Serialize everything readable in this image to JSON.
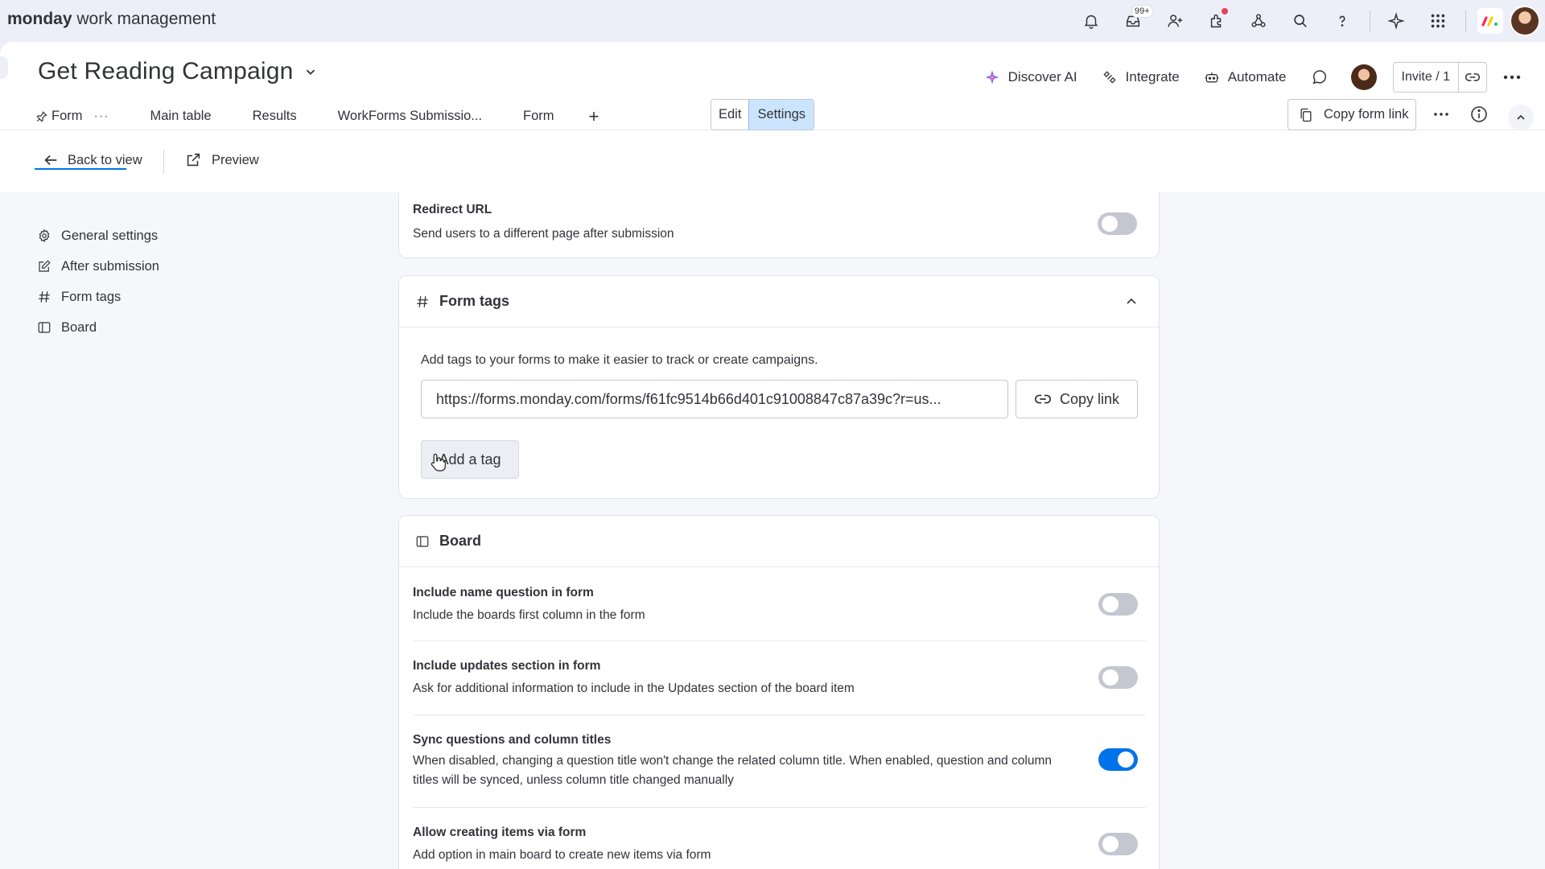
{
  "topbar": {
    "brand_bold": "monday",
    "brand_rest": " work management",
    "inbox_badge": "99+",
    "icons": [
      "bell-icon",
      "inbox-icon",
      "invite-members-icon",
      "apps-icon",
      "integrations-icon",
      "search-icon",
      "help-icon",
      "ai-sparkle-icon",
      "app-switcher-icon"
    ]
  },
  "board": {
    "title": "Get Reading Campaign",
    "actions": {
      "discover_ai": "Discover AI",
      "integrate": "Integrate",
      "automate": "Automate",
      "invite": "Invite / 1"
    },
    "tabs": [
      {
        "label": "Form",
        "active": true
      },
      {
        "label": "Main table"
      },
      {
        "label": "Results"
      },
      {
        "label": "WorkForms Submissio..."
      },
      {
        "label": "Form"
      }
    ],
    "add_tab": "+",
    "tab_more": "···"
  },
  "toolbar": {
    "back": "Back to view",
    "preview": "Preview",
    "edit": "Edit",
    "settings": "Settings",
    "copy_form_link": "Copy form link"
  },
  "sidenav": [
    {
      "label": "General settings",
      "icon": "gear-icon"
    },
    {
      "label": "After submission",
      "icon": "edit-icon"
    },
    {
      "label": "Form tags",
      "icon": "hash-icon"
    },
    {
      "label": "Board",
      "icon": "board-icon"
    }
  ],
  "redirect": {
    "title": "Redirect URL",
    "desc": "Send users to a different page after submission",
    "enabled": false
  },
  "form_tags": {
    "title": "Form tags",
    "desc": "Add tags to your forms to make it easier to track or create campaigns.",
    "url": "https://forms.monday.com/forms/f61fc9514b66d401c91008847c87a39c?r=us...",
    "copy_link": "Copy link",
    "add_tag": "Add a tag"
  },
  "board_section": {
    "title": "Board",
    "settings": [
      {
        "title": "Include name question in form",
        "desc": "Include the boards first column in the form",
        "enabled": false
      },
      {
        "title": "Include updates section in form",
        "desc": "Ask for additional information to include in the Updates section of the board item",
        "enabled": false
      },
      {
        "title": "Sync questions and column titles",
        "desc": "When disabled, changing a question title won't change the related column title. When enabled, question and column titles will be synced, unless column title changed manually",
        "enabled": true
      },
      {
        "title": "Allow creating items via form",
        "desc": "Add option in main board to create new items via form",
        "enabled": false
      }
    ]
  },
  "colors": {
    "accent": "#0073ea",
    "selected_bg": "#cce5ff",
    "toggle_off": "#c5c7d0",
    "surface": "#eceff8"
  }
}
